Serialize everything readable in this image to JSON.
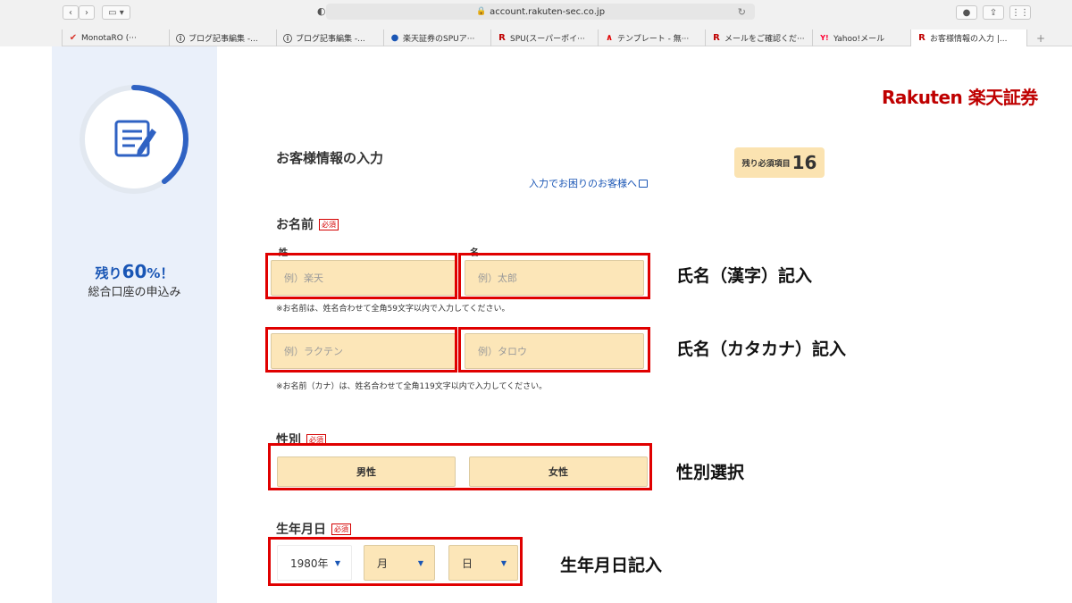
{
  "browser": {
    "url": "account.rakuten-sec.co.jp",
    "tabs": [
      {
        "icon": "monotaro-icon",
        "glyph": "✔",
        "label": "MonotaRO (···"
      },
      {
        "icon": "info-icon",
        "glyph": "ⓘ",
        "label": "ブログ記事編集 -..."
      },
      {
        "icon": "info-icon",
        "glyph": "ⓘ",
        "label": "ブログ記事編集 -..."
      },
      {
        "icon": "globe-icon",
        "glyph": "●",
        "label": "楽天証券のSPUア···"
      },
      {
        "icon": "rakuten-r-icon",
        "glyph": "R",
        "label": "SPU(スーパーポイ···"
      },
      {
        "icon": "template-icon",
        "glyph": "∧",
        "label": "テンプレート - 無···"
      },
      {
        "icon": "rakuten-r-icon",
        "glyph": "R",
        "label": "メールをご確認くだ···"
      },
      {
        "icon": "yahoo-icon",
        "glyph": "Y!",
        "label": "Yahoo!メール"
      },
      {
        "icon": "rakuten-r-icon",
        "glyph": "R",
        "label": "お客様情報の入力 |..."
      }
    ],
    "new_tab": "+"
  },
  "sidebar": {
    "progress_pct_prefix": "残り",
    "progress_pct_value": "60",
    "progress_pct_suffix": "%！",
    "progress_fraction": 0.4,
    "subtitle": "総合口座の申込み"
  },
  "logo": {
    "text": "Rakuten 楽天証券"
  },
  "form": {
    "section_title": "お客様情報の入力",
    "remaining_label": "残り必須項目",
    "remaining_count": "16",
    "help_link": "入力でお困りのお客様へ",
    "required_badge": "必須",
    "name": {
      "label": "お名前",
      "last_label": "姓",
      "first_label": "名",
      "last_placeholder": "例）楽天",
      "first_placeholder": "例）太郎",
      "note": "※お名前は、姓名合わせて全角59文字以内で入力してください。"
    },
    "kana": {
      "last_placeholder": "例）ラクテン",
      "first_placeholder": "例）タロウ",
      "note": "※お名前（カナ）は、姓名合わせて全角119文字以内で入力してください。"
    },
    "gender": {
      "label": "性別",
      "male": "男性",
      "female": "女性"
    },
    "birth": {
      "label": "生年月日",
      "year": "1980年",
      "month": "月",
      "day": "日"
    }
  },
  "annotations": {
    "name_kanji": "氏名（漢字）記入",
    "name_kana": "氏名（カタカナ）記入",
    "gender": "性別選択",
    "birth": "生年月日記入"
  },
  "colors": {
    "accent": "#1a56b5",
    "field": "#fce6b8",
    "highlight": "#e00000",
    "brand": "#bf0000"
  }
}
